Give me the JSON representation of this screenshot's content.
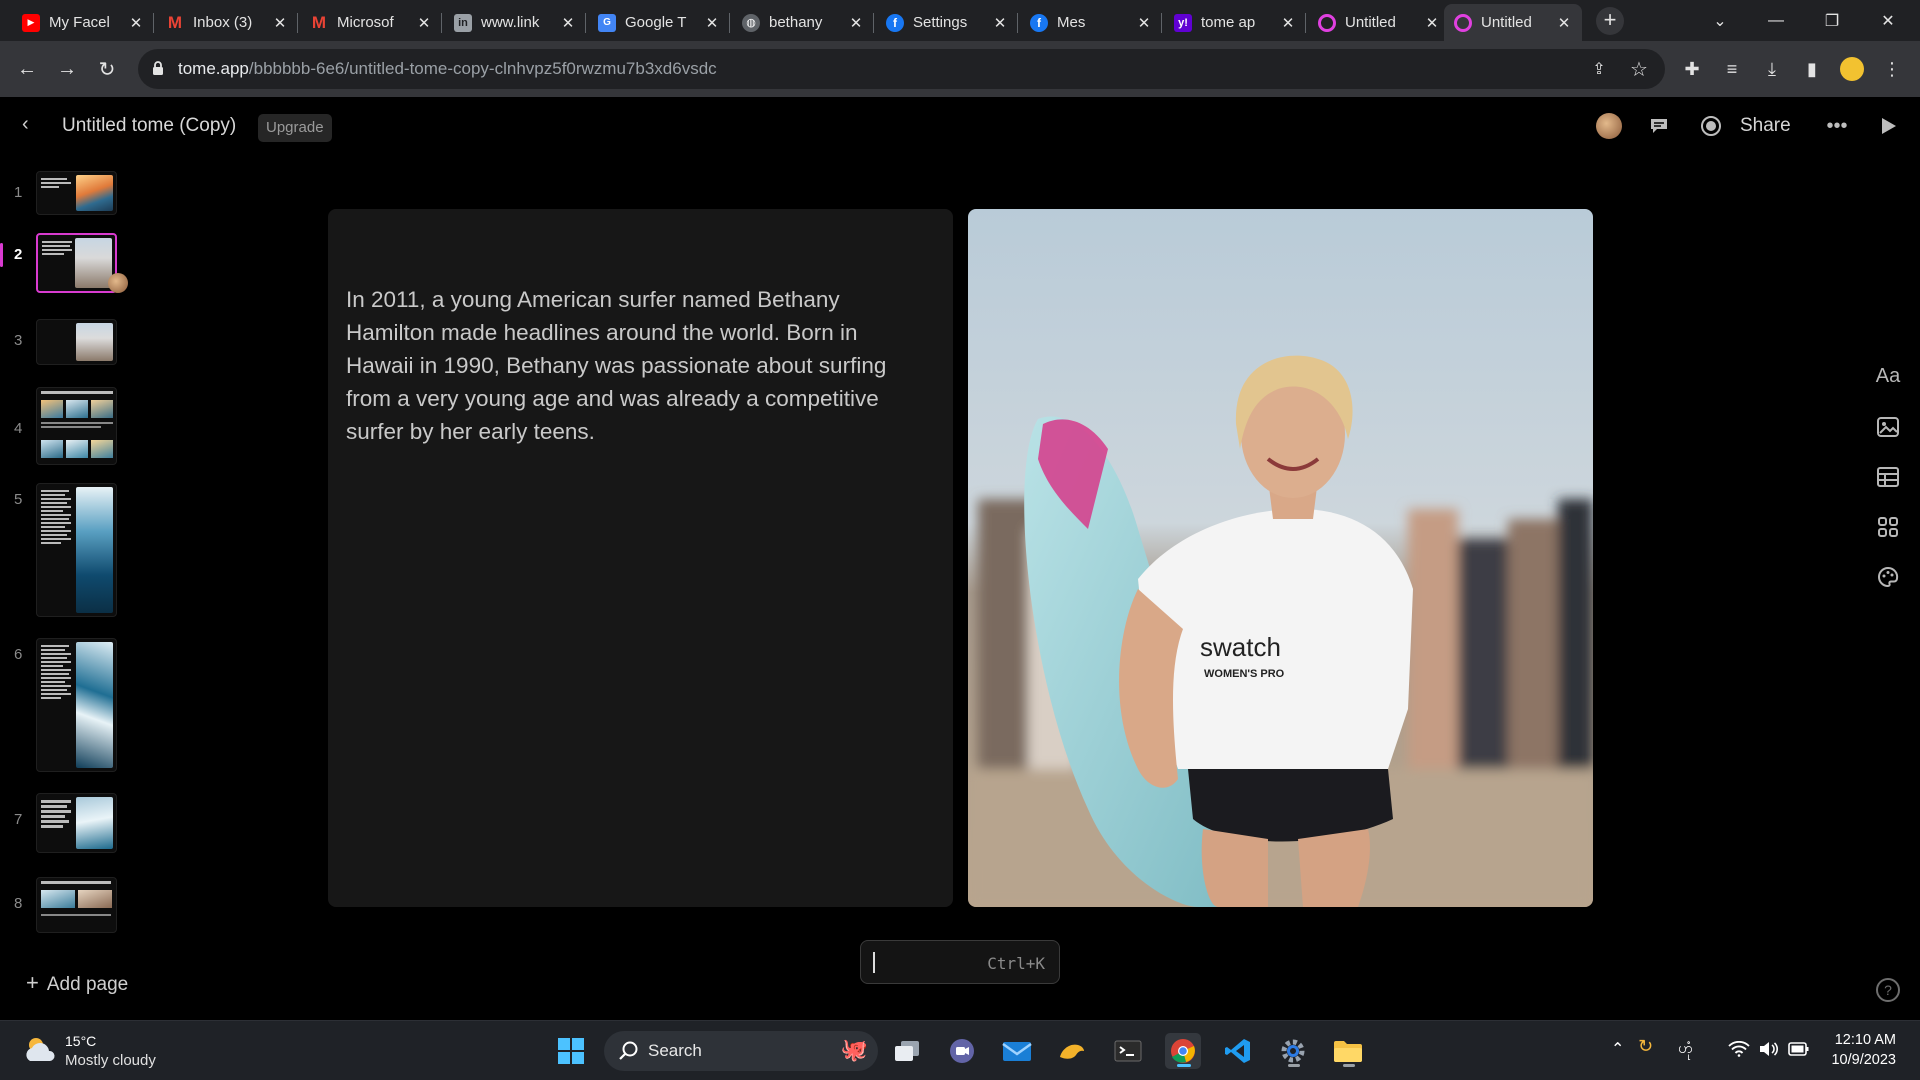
{
  "browser": {
    "tabs": [
      {
        "title": "My Facel",
        "icon": "youtube-icon"
      },
      {
        "title": "Inbox (3)",
        "icon": "gmail-icon"
      },
      {
        "title": "Microsof",
        "icon": "gmail-icon"
      },
      {
        "title": "www.link",
        "icon": "linkedin-icon"
      },
      {
        "title": "Google T",
        "icon": "google-translate-icon"
      },
      {
        "title": "bethany",
        "icon": "globe-icon"
      },
      {
        "title": "Settings",
        "icon": "facebook-icon"
      },
      {
        "title": "Mes",
        "icon": "facebook-icon"
      },
      {
        "title": "tome ap",
        "icon": "yahoo-icon"
      },
      {
        "title": "Untitled",
        "icon": "tome-icon"
      },
      {
        "title": "Untitled",
        "icon": "tome-icon",
        "active": true
      }
    ],
    "url_domain": "tome.app",
    "url_path": "/bbbbbb-6e6/untitled-tome-copy-clnhvpz5f0rwzmu7b3xd6vsdc"
  },
  "app": {
    "doc_title": "Untitled tome (Copy)",
    "upgrade_label": "Upgrade",
    "share_label": "Share",
    "add_page_label": "Add page",
    "pages": [
      "1",
      "2",
      "3",
      "4",
      "5",
      "6",
      "7",
      "8"
    ],
    "current_page": "2",
    "body_text": "In 2011, a young American surfer named Bethany Hamilton made headlines around the world. Born in Hawaii in 1990, Bethany was passionate about surfing from a very young age and was already a competitive surfer by her early teens.",
    "right_tools": [
      "Aa"
    ],
    "command_shortcut": "Ctrl+K"
  },
  "taskbar": {
    "temperature": "15°C",
    "weather": "Mostly cloudy",
    "search_label": "Search",
    "time": "12:10 AM",
    "date": "10/9/2023",
    "language": "ဟုံ"
  },
  "colors": {
    "accent": "#d93bd0",
    "card": "#171717",
    "background": "#000000"
  }
}
